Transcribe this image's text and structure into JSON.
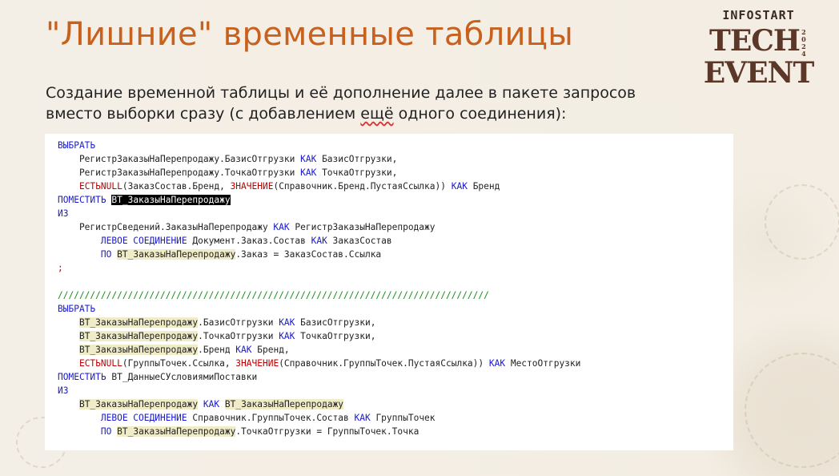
{
  "slide": {
    "title": "\"Лишние\" временные таблицы",
    "subtitle_line1": "Создание временной таблицы и её дополнение далее в пакете запросов",
    "subtitle_line2_a": "вместо выборки сразу (с добавлением ",
    "subtitle_line2_b": "ещё",
    "subtitle_line2_c": " одного соединения):"
  },
  "logo": {
    "top": "INFOSTART",
    "bottom_left": "TECH",
    "bottom_year": "2024",
    "bottom_right": "EVENT"
  },
  "code": {
    "l1_kw": "ВЫБРАТЬ",
    "l2": "    РегистрЗаказыНаПерепродажу.БазисОтгрузки ",
    "l2_kw": "КАК",
    "l2_b": " БазисОтгрузки,",
    "l3": "    РегистрЗаказыНаПерепродажу.ТочкаОтгрузки ",
    "l3_kw": "КАК",
    "l3_b": " ТочкаОтгрузки,",
    "l4_fn": "ЕСТЬNULL",
    "l4_a": "(ЗаказСостав.Бренд, ",
    "l4_fn2": "ЗНАЧЕНИЕ",
    "l4_b": "(Справочник.Бренд.ПустаяСсылка)) ",
    "l4_kw": "КАК",
    "l4_c": " Бренд",
    "l5_kw": "ПОМЕСТИТЬ",
    "l5_sel": "ВТ_ЗаказыНаПерепродажу",
    "l6_kw": "ИЗ",
    "l7": "    РегистрСведений.ЗаказыНаПерепродажу ",
    "l7_kw": "КАК",
    "l7_b": " РегистрЗаказыНаПерепродажу",
    "l8_kw": "ЛЕВОЕ СОЕДИНЕНИЕ",
    "l8_a": " Документ.Заказ.Состав ",
    "l8_kw2": "КАК",
    "l8_b": " ЗаказСостав",
    "l9_kw": "ПО",
    "l9_hl": "ВТ_ЗаказыНаПерепродажу",
    "l9_a": ".Заказ = ЗаказСостав.Ссылка",
    "l10": ";",
    "l12": "////////////////////////////////////////////////////////////////////////////////",
    "l13_kw": "ВЫБРАТЬ",
    "l14_hl": "ВТ_ЗаказыНаПерепродажу",
    "l14_a": ".БазисОтгрузки ",
    "l14_kw": "КАК",
    "l14_b": " БазисОтгрузки,",
    "l15_hl": "ВТ_ЗаказыНаПерепродажу",
    "l15_a": ".ТочкаОтгрузки ",
    "l15_kw": "КАК",
    "l15_b": " ТочкаОтгрузки,",
    "l16_hl": "ВТ_ЗаказыНаПерепродажу",
    "l16_a": ".Бренд ",
    "l16_kw": "КАК",
    "l16_b": " Бренд,",
    "l17_fn": "ЕСТЬNULL",
    "l17_a": "(ГруппыТочек.Ссылка, ",
    "l17_fn2": "ЗНАЧЕНИЕ",
    "l17_b": "(Справочник.ГруппыТочек.ПустаяСсылка)) ",
    "l17_kw": "КАК",
    "l17_c": " МестоОтгрузки",
    "l18_kw": "ПОМЕСТИТЬ",
    "l18_a": " ВТ_ДанныеСУсловиямиПоставки",
    "l19_kw": "ИЗ",
    "l20_hl": "ВТ_ЗаказыНаПерепродажу",
    "l20_kw": "КАК",
    "l20_hl2": "ВТ_ЗаказыНаПерепродажу",
    "l21_kw": "ЛЕВОЕ СОЕДИНЕНИЕ",
    "l21_a": " Справочник.ГруппыТочек.Состав ",
    "l21_kw2": "КАК",
    "l21_b": " ГруппыТочек",
    "l22_kw": "ПО",
    "l22_hl": "ВТ_ЗаказыНаПерепродажу",
    "l22_a": ".ТочкаОтгрузки = ГруппыТочек.Точка"
  }
}
